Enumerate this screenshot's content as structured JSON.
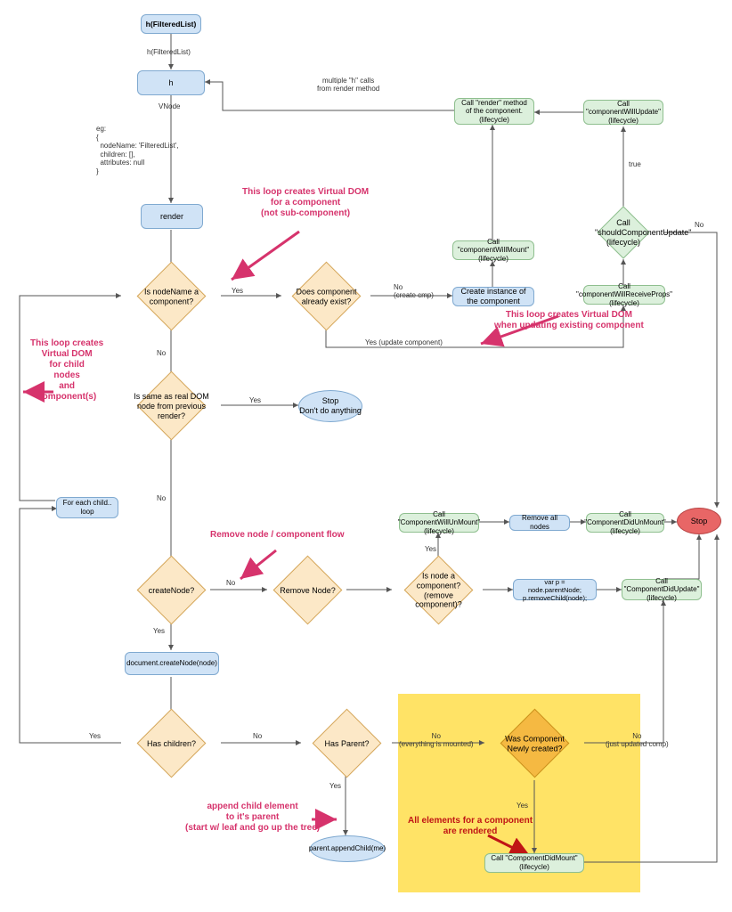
{
  "nodes": {
    "start": "h(FilteredList)",
    "start_sub": "h(FilteredList)",
    "h": "h",
    "vnode": "VNode",
    "vnode_eg": "eg:\n{\n  nodeName: 'FilteredList',\n  children: [],\n  attributes: null\n}",
    "render": "render",
    "is_nodename_comp": "Is nodeName a component?",
    "comp_exist": "Does component already exist?",
    "create_instance": "Create instance of the component",
    "will_mount": "Call \"componentWillMount\" (lifecycle)",
    "call_render": "Call \"render\" method of the component. (lifecycle)",
    "will_update": "Call \"componentWillUpdate\" (lifecycle)",
    "should_update": "Call \"shouldComponentUpdate\" (lifecycle)",
    "will_receive": "Call \"componentWillReceiveProps\" (lifecycle)",
    "same_as_real": "Is same as real DOM node from previous render?",
    "stop_dont": "Stop\nDon't do anything",
    "for_each_child": "For each child.. loop",
    "create_node_q": "createNode?",
    "remove_node_q": "Remove Node?",
    "is_node_comp": "Is node a component? (remove component)?",
    "var_p": "var p = node.parentNode; p.removeChild(node);",
    "will_unmount": "Call \"ComponentWillUnMount\" (lifecycle)",
    "remove_all": "Remove all nodes",
    "did_unmount": "Call \"ComponentDidUnMount\" (lifecycle)",
    "stop": "Stop",
    "did_update": "Call \"ComponentDidUpdate\" (lifecycle)",
    "doc_create": "document.createNode(node)",
    "has_children": "Has children?",
    "has_parent": "Has Parent?",
    "newly_created": "Was Component Newly created?",
    "append_child": "parent.appendChild(me)",
    "did_mount": "Call \"ComponentDidMount\" (lifecycle)"
  },
  "edge_labels": {
    "yes": "Yes",
    "no": "No",
    "true": "true",
    "no_create": "No\n(create cmp)",
    "yes_update": "Yes (update component)",
    "no_mounted": "No\n(everything is mounted)",
    "no_just_updated": "No\n(just updated comp)",
    "multiple_h": "multiple \"h\" calls\nfrom render method"
  },
  "annotations": {
    "loop_creates_vdom_comp": "This loop creates Virtual DOM\nfor a component\n(not sub-component)",
    "loop_creates_vdom_update": "This loop creates Virtual DOM\nwhen updating existing component",
    "loop_child_nodes": "This loop creates\nVirtual DOM\nfor child\nnodes\nand\ncomponent(s)",
    "remove_flow": "Remove node / component flow",
    "append_child_text": "append child element\nto it's parent\n(start w/ leaf and go up the tree)",
    "all_rendered": "All elements for a component\nare rendered"
  }
}
